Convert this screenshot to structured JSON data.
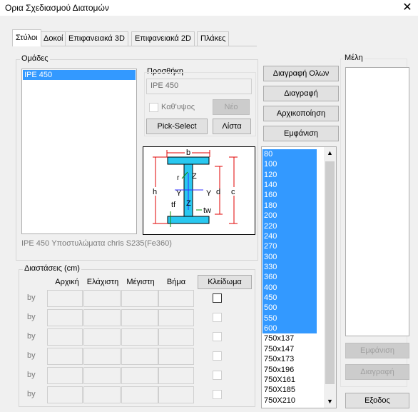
{
  "window": {
    "title": "Ορια Σχεδιασμού Διατομών",
    "close_glyph": "✕"
  },
  "tabs": [
    "Στύλοι",
    "Δοκοί",
    "Επιφανειακά 3D",
    "Επιφανειακά 2D",
    "Πλάκες"
  ],
  "groups": {
    "label": "Ομάδες",
    "items": [
      "IPE 450"
    ],
    "add": {
      "label": "Προσθήκη",
      "value": "IPE 450",
      "vertical_label": "Καθ'υψος",
      "new_button": "Νέο",
      "pick_select_button": "Pick-Select",
      "list_button": "Λίστα"
    },
    "description": "IPE 450 Υποστυλώματα chris S235(Fe360)"
  },
  "actions": {
    "delete_all": "Διαγραφή Ολων",
    "delete": "Διαγραφή",
    "initialize": "Αρχικοποίηση",
    "show": "Εμφάνιση"
  },
  "section_diagram": {
    "labels": {
      "b": "b",
      "h": "h",
      "d": "d",
      "c": "c",
      "r": "r",
      "Z": "Z",
      "Y": "Y",
      "tf": "tf",
      "tw": "tw"
    },
    "colors": {
      "flange": "#29c8f0",
      "dim": "#e00000",
      "axis": "#3030ff",
      "bg": "#ffffff"
    }
  },
  "sizes": {
    "items": [
      "80",
      "100",
      "120",
      "140",
      "160",
      "180",
      "200",
      "220",
      "240",
      "270",
      "300",
      "330",
      "360",
      "400",
      "450",
      "500",
      "550",
      "600",
      "750x137",
      "750x147",
      "750x173",
      "750x196",
      "750X161",
      "750X185",
      "750X210"
    ],
    "selected_count": 18
  },
  "dimensions": {
    "label": "Διαστάσεις (cm)",
    "headers": {
      "initial": "Αρχική",
      "min": "Ελάχιστη",
      "max": "Μέγιστη",
      "step": "Βήμα",
      "lock": "Κλείδωμα"
    },
    "row_label": "by",
    "rows": 6
  },
  "members": {
    "label": "Μέλη",
    "show_button": "Εμφάνιση",
    "delete_button": "Διαγραφή"
  },
  "exit_button": "Εξοδος",
  "colors": {
    "selection": "#3399ff",
    "window_bg": "#f0f0f0"
  }
}
